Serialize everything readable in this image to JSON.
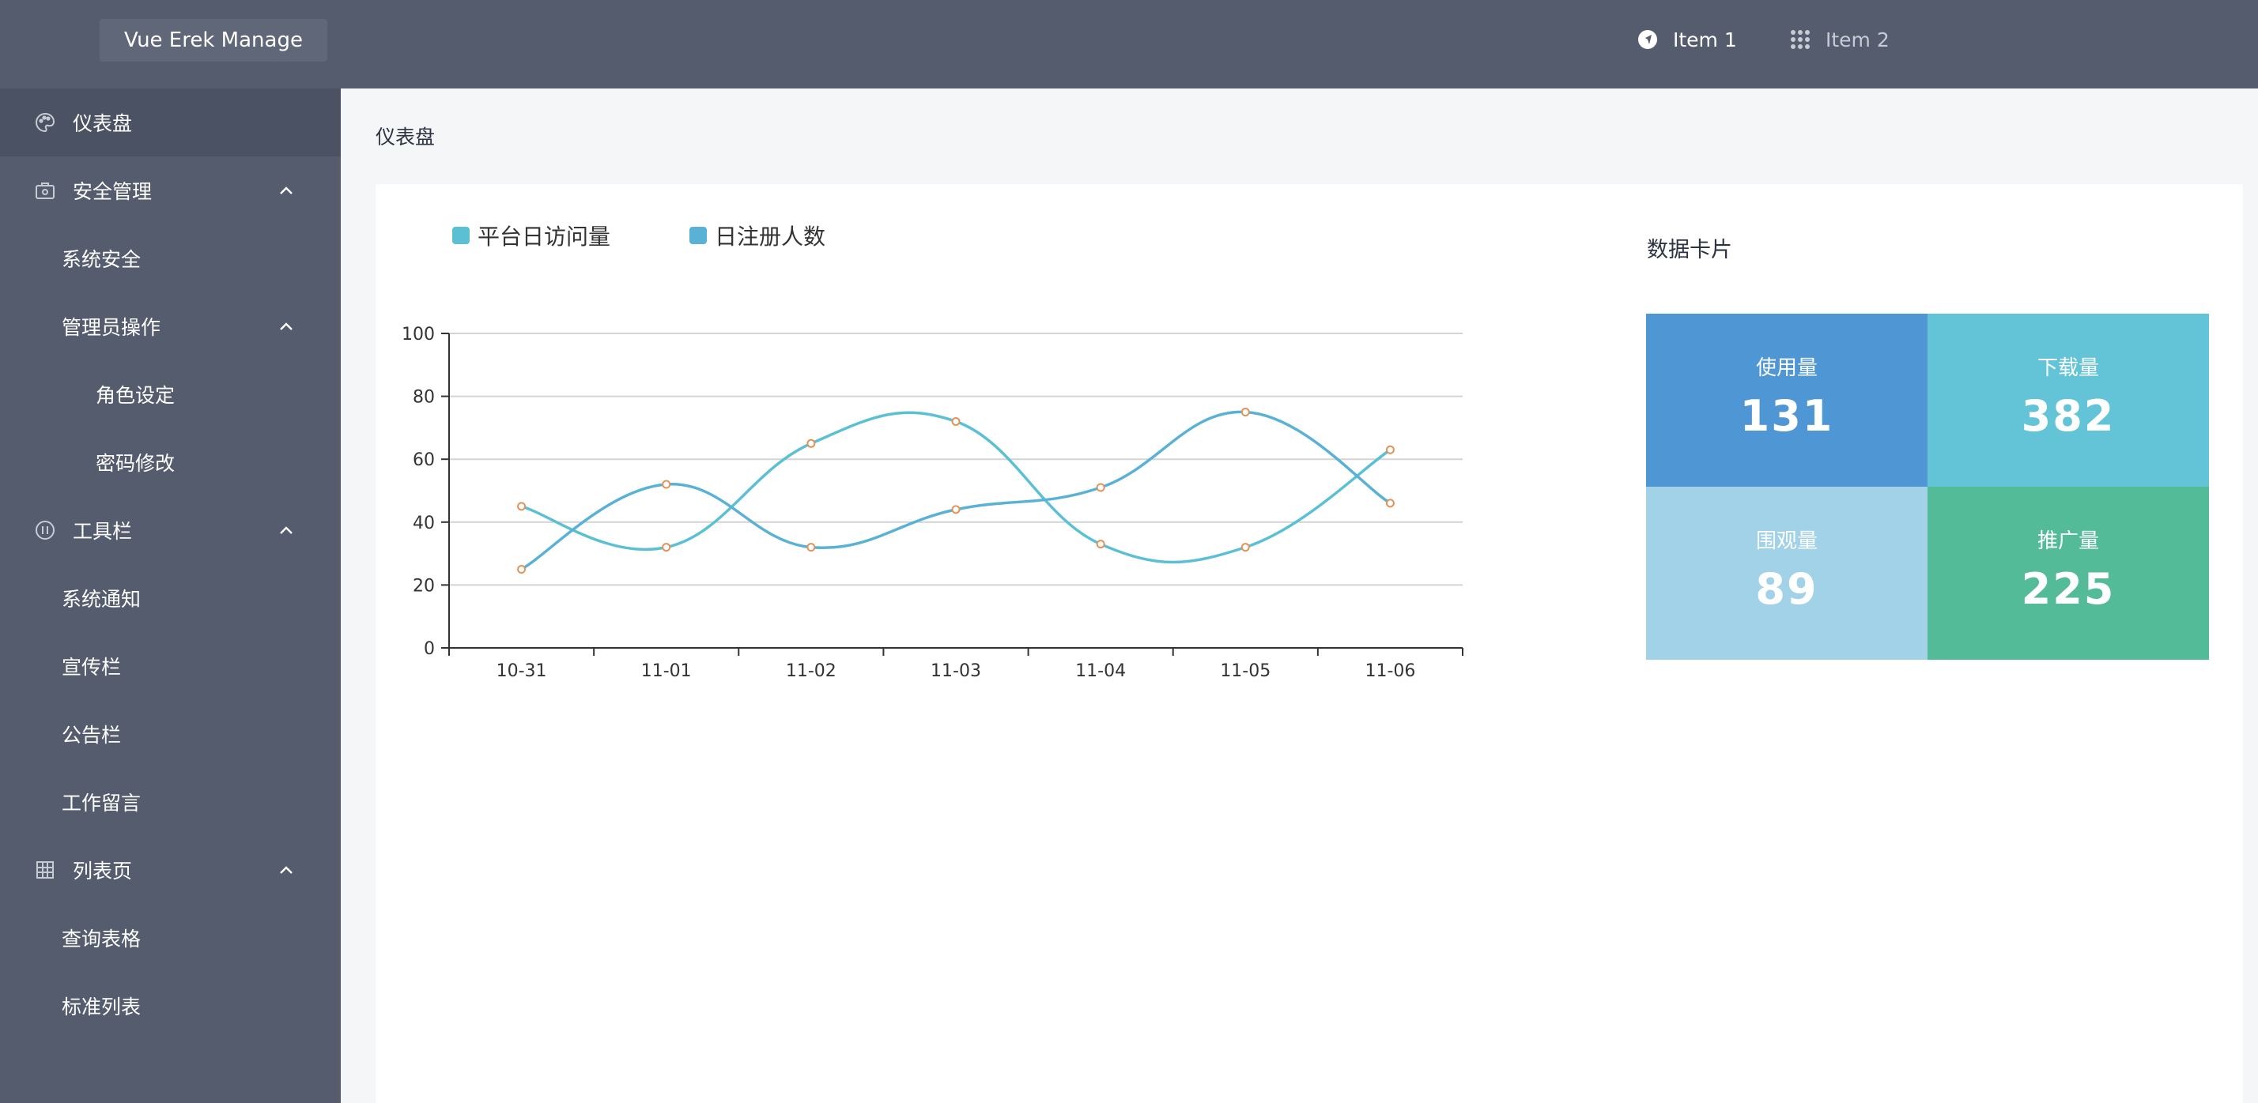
{
  "app": {
    "title": "Vue Erek Manage"
  },
  "topnav": {
    "item1": "Item 1",
    "item2": "Item 2"
  },
  "sidebar": {
    "items": [
      {
        "label": "仪表盘",
        "icon": "palette-icon"
      },
      {
        "label": "安全管理",
        "icon": "lock-case-icon"
      },
      {
        "label": "系统安全"
      },
      {
        "label": "管理员操作"
      },
      {
        "label": "角色设定"
      },
      {
        "label": "密码修改"
      },
      {
        "label": "工具栏",
        "icon": "face-icon"
      },
      {
        "label": "系统通知"
      },
      {
        "label": "宣传栏"
      },
      {
        "label": "公告栏"
      },
      {
        "label": "工作留言"
      },
      {
        "label": "列表页",
        "icon": "grid-icon"
      },
      {
        "label": "查询表格"
      },
      {
        "label": "标准列表"
      }
    ]
  },
  "page": {
    "title": "仪表盘"
  },
  "chart_data": {
    "type": "line",
    "categories": [
      "10-31",
      "11-01",
      "11-02",
      "11-03",
      "11-04",
      "11-05",
      "11-06"
    ],
    "series": [
      {
        "name": "平台日访问量",
        "color": "#5bc0d3",
        "values": [
          45,
          32,
          65,
          72,
          33,
          32,
          63
        ]
      },
      {
        "name": "日注册人数",
        "color": "#5ab1d6",
        "values": [
          25,
          52,
          32,
          44,
          51,
          75,
          46
        ]
      }
    ],
    "ylim": [
      0,
      100
    ],
    "yticks": [
      0,
      20,
      40,
      60,
      80,
      100
    ],
    "grid": true,
    "smooth": true,
    "legend": "top-left"
  },
  "cards": {
    "title": "数据卡片",
    "items": [
      {
        "label": "使用量",
        "value": "131",
        "color": "#4f96d5"
      },
      {
        "label": "下载量",
        "value": "382",
        "color": "#62c4d6"
      },
      {
        "label": "围观量",
        "value": "89",
        "color": "#a1d2e8"
      },
      {
        "label": "推广量",
        "value": "225",
        "color": "#53bb98"
      }
    ]
  }
}
